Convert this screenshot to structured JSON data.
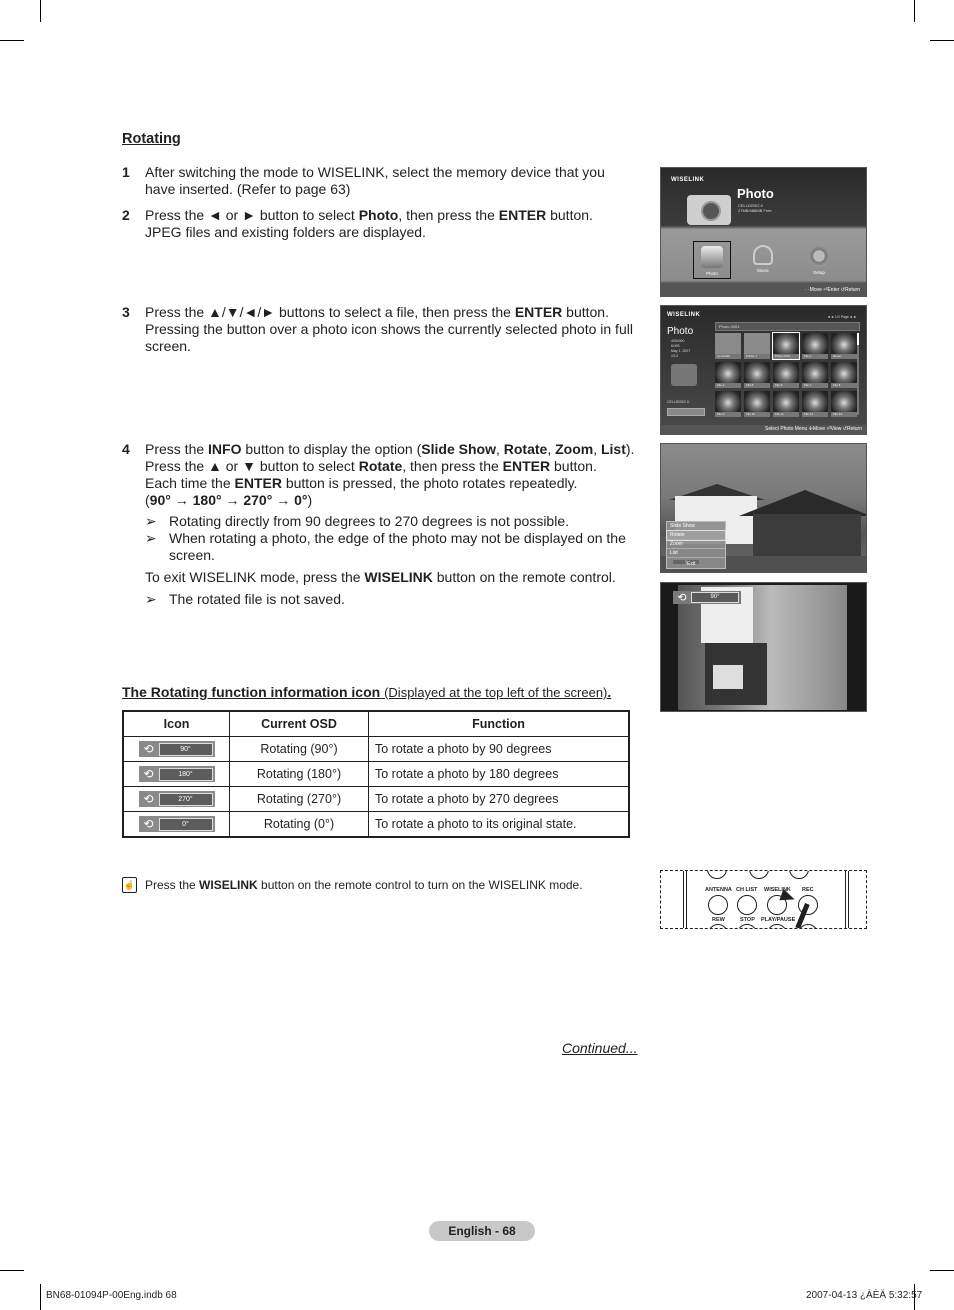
{
  "section": {
    "title": "Rotating"
  },
  "steps": [
    {
      "num": "1",
      "text": "After switching the mode to WISELINK, select the memory device that you have inserted. (Refer to page 63)"
    },
    {
      "num": "2",
      "line1_a": "Press the ◄ or ► button to select ",
      "line1_b": "Photo",
      "line1_c": ", then press the ",
      "line1_d": "ENTER",
      "line1_e": " button.",
      "line2": "JPEG files and existing folders are displayed."
    },
    {
      "num": "3",
      "line1_a": "Press the ▲/▼/◄/► buttons to select a file, then press the ",
      "line1_b": "ENTER",
      "line1_c": " button.",
      "line2": "Pressing the button over a photo icon shows the currently selected photo in full screen."
    },
    {
      "num": "4",
      "p1": [
        "Press the ",
        "INFO",
        " button to display the option (",
        "Slide Show",
        ", ",
        "Rotate",
        ", ",
        "Zoom",
        ", ",
        "List",
        ")."
      ],
      "p2": [
        "Press the ▲ or ▼ button to select ",
        "Rotate",
        ", then press the ",
        "ENTER",
        " button."
      ],
      "p3": [
        "Each time the ",
        "ENTER",
        " button is pressed, the photo rotates repeatedly."
      ],
      "p4": [
        "(",
        "90° → 180° → 270° → 0°",
        ")"
      ],
      "notes": [
        "Rotating directly from 90 degrees to 270 degrees is not possible.",
        "When rotating a photo, the edge of the photo may not be displayed on the screen."
      ],
      "exit": [
        "To exit WISELINK mode, press the ",
        "WISELINK",
        " button on the remote control."
      ],
      "note_last": "The rotated file is not saved."
    }
  ],
  "note_arrow": "➢",
  "info_section": {
    "title": "The Rotating function information icon",
    "subtitle": "(Displayed at the top left of the screen)",
    "period": "."
  },
  "table": {
    "headers": [
      "Icon",
      "Current OSD",
      "Function"
    ],
    "rows": [
      {
        "icon_value": "90°",
        "osd": "Rotating (90°)",
        "function": "To rotate a photo by 90 degrees"
      },
      {
        "icon_value": "180°",
        "osd": "Rotating (180°)",
        "function": "To rotate a photo by 180 degrees"
      },
      {
        "icon_value": "270°",
        "osd": "Rotating (270°)",
        "function": "To rotate a photo by 270 degrees"
      },
      {
        "icon_value": "0°",
        "osd": "Rotating (0°)",
        "function": "To rotate a photo to its original state."
      }
    ],
    "rotate_icon": "rotate-icon"
  },
  "remote_note": {
    "a": "Press the ",
    "b": "WISELINK",
    "c": " button on the remote control to turn on the WISELINK mode."
  },
  "continued": "Continued...",
  "page_badge": "English - 68",
  "footer": {
    "left": "BN68-01094P-00Eng.indb   68",
    "right": "2007-04-13   ¿ÀÈÄ 5:32:57"
  },
  "screens": {
    "wiselink_home": {
      "logo": "WISELINK",
      "title": "Photo",
      "meta1": "CELLDISK2.0",
      "meta2": "27MB/488MB Free",
      "menu": [
        "Photo",
        "Music",
        "Setup"
      ],
      "bar": "· ·Move   ⏎Enter   ↺Return"
    },
    "photo_browser": {
      "logo": "WISELINK",
      "title": "Photo",
      "meta": [
        "400x300",
        "61KB",
        "May 1, 2007",
        "1/14"
      ],
      "device": "CELLDISK2.0",
      "device_free": "27MB/488MB Free",
      "path": "Photo 0001",
      "pager": "◄◄ 1/2 Page ►►",
      "thumbs": [
        "Up Folder",
        "Folder 1",
        "Photo 0001",
        "File 2",
        "Name",
        "File 4",
        "File 5",
        "File 6",
        "File 7",
        "File 8",
        "File 9",
        "File 10",
        "File 11",
        "File 12",
        "File 13"
      ],
      "bar": "Select   Photo Menu  ✢Move  ⏎View  ↺Return"
    },
    "option_menu": {
      "items": [
        "Slide Show",
        "Rotate",
        "Zoom",
        "List"
      ],
      "selected": "Rotate",
      "exit": "Exit"
    },
    "rotated": {
      "osd_value": "90°"
    }
  },
  "remote": {
    "labels_top": [
      "ANTENNA",
      "CH LIST",
      "WISELINK",
      "REC"
    ],
    "labels_bottom": [
      "REW",
      "STOP",
      "PLAY/PAUSE"
    ]
  }
}
